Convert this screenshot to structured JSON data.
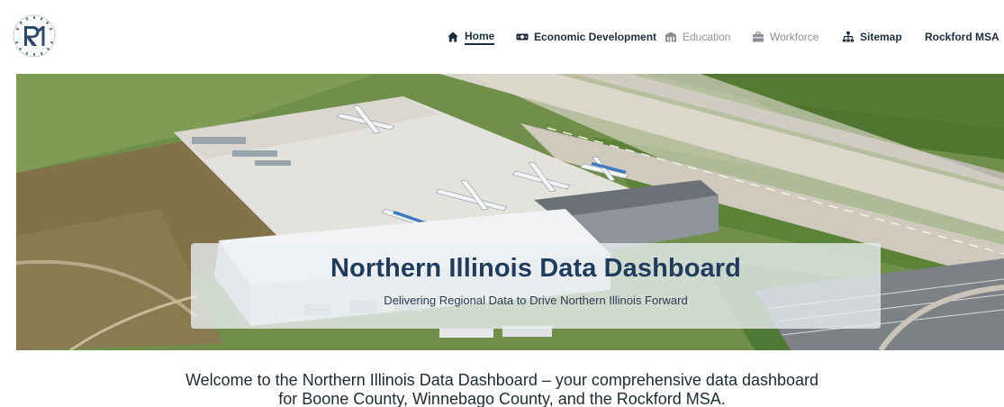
{
  "logo": {
    "mark": "R1",
    "ring_text": "REGION 1 PLANNING COUNCIL"
  },
  "nav": {
    "items": [
      {
        "label": "Home",
        "icon": "home-icon",
        "active": true
      },
      {
        "label": "Economic Development",
        "icon": "money-icon"
      },
      {
        "label": "Education",
        "icon": "school-icon",
        "muted": true
      },
      {
        "label": "Workforce",
        "icon": "briefcase-icon",
        "muted": true
      },
      {
        "label": "Sitemap",
        "icon": "sitemap-icon"
      },
      {
        "label": "Rockford MSA",
        "dropdown": true
      }
    ]
  },
  "hero": {
    "title": "Northern Illinois Data Dashboard",
    "subtitle": "Delivering Regional Data to Drive Northern Illinois Forward"
  },
  "welcome": {
    "line1": "Welcome to the Northern Illinois Data Dashboard – your comprehensive data dashboard",
    "line2": "for Boone County, Winnebago County, and the Rockford MSA."
  },
  "colors": {
    "nav_text": "#1d2d3d",
    "nav_muted": "#8a8f96",
    "title": "#1f3b5e",
    "grass": "#5f8a3c",
    "runway": "#d9d6cc",
    "roof": "#f1f3f4"
  }
}
